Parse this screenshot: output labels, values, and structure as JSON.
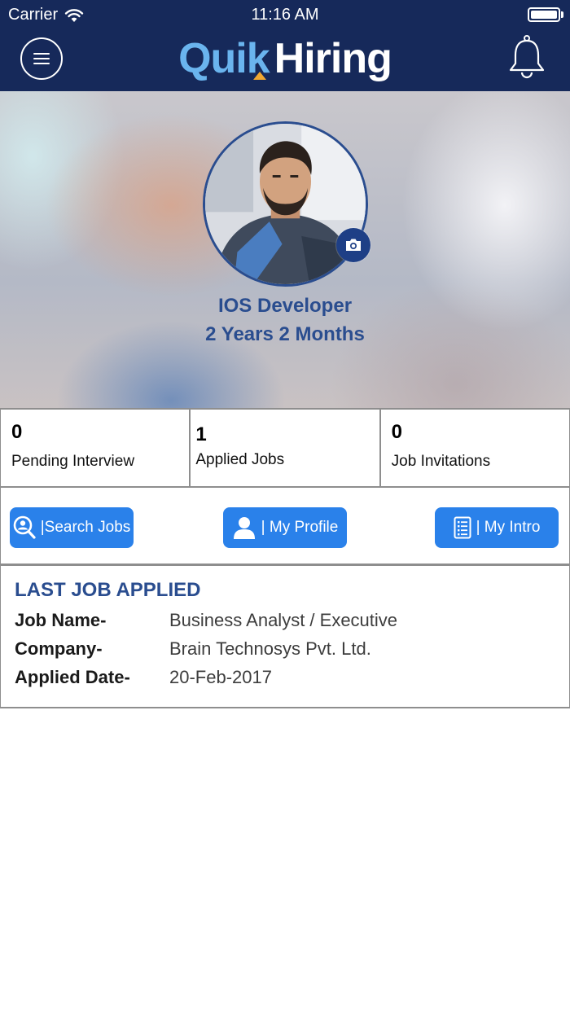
{
  "status_bar": {
    "carrier": "Carrier",
    "time": "11:16 AM"
  },
  "header": {
    "logo_part1": "Quik",
    "logo_part2": "Hiring",
    "brand_colors": {
      "bar": "#16295a",
      "logo_quik": "#6ab4ee",
      "logo_hiring": "#ffffff",
      "accent": "#f0a732"
    },
    "icons": [
      "menu-icon",
      "bell-icon"
    ]
  },
  "profile": {
    "title": "IOS Developer",
    "experience": "2 Years 2 Months",
    "icons": [
      "camera-icon"
    ]
  },
  "stats": [
    {
      "count": "0",
      "label": "Pending Interview"
    },
    {
      "count": "1",
      "label": "Applied Jobs"
    },
    {
      "count": "0",
      "label": "Job Invitations"
    }
  ],
  "actions": {
    "search": "|Search Jobs",
    "profile": "| My Profile",
    "intro": "| My Intro",
    "button_color": "#2a81ea"
  },
  "last_job": {
    "heading": "LAST JOB APPLIED",
    "rows": [
      {
        "label": "Job Name-",
        "value": "Business Analyst / Executive"
      },
      {
        "label": "Company-",
        "value": "Brain Technosys Pvt. Ltd."
      },
      {
        "label": "Applied Date-",
        "value": "20-Feb-2017"
      }
    ]
  }
}
